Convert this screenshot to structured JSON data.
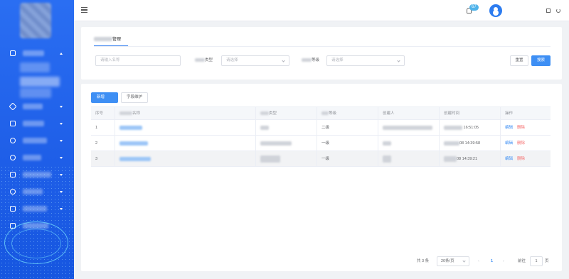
{
  "header": {
    "notification_count": "67"
  },
  "page": {
    "tab_title": "管理"
  },
  "filters": {
    "name_placeholder": "请输入名称",
    "type_label": "类型",
    "type_placeholder": "请选择",
    "level_label": "等级",
    "level_placeholder": "请选择",
    "reset_label": "重置",
    "search_label": "搜索"
  },
  "toolbar": {
    "add_label": "新增",
    "field_maintain_label": "字段维护"
  },
  "table": {
    "columns": [
      "序号",
      "名称",
      "类型",
      "等级",
      "创建人",
      "创建时间",
      "操作"
    ],
    "rows": [
      {
        "index": "1",
        "level": "二级",
        "created_time": "16:51:05",
        "edit": "编辑",
        "delete": "删除"
      },
      {
        "index": "2",
        "level": "一级",
        "created_time": "08 14:39:58",
        "edit": "编辑",
        "delete": "删除"
      },
      {
        "index": "3",
        "level": "一级",
        "created_time": "08 14:39:21",
        "edit": "编辑",
        "delete": "删除"
      }
    ]
  },
  "pagination": {
    "total": "共 3 条",
    "page_size": "20条/页",
    "prev": "‹",
    "current": "1",
    "next": "›",
    "goto_label": "前往",
    "goto_value": "1",
    "page_unit": "页"
  }
}
